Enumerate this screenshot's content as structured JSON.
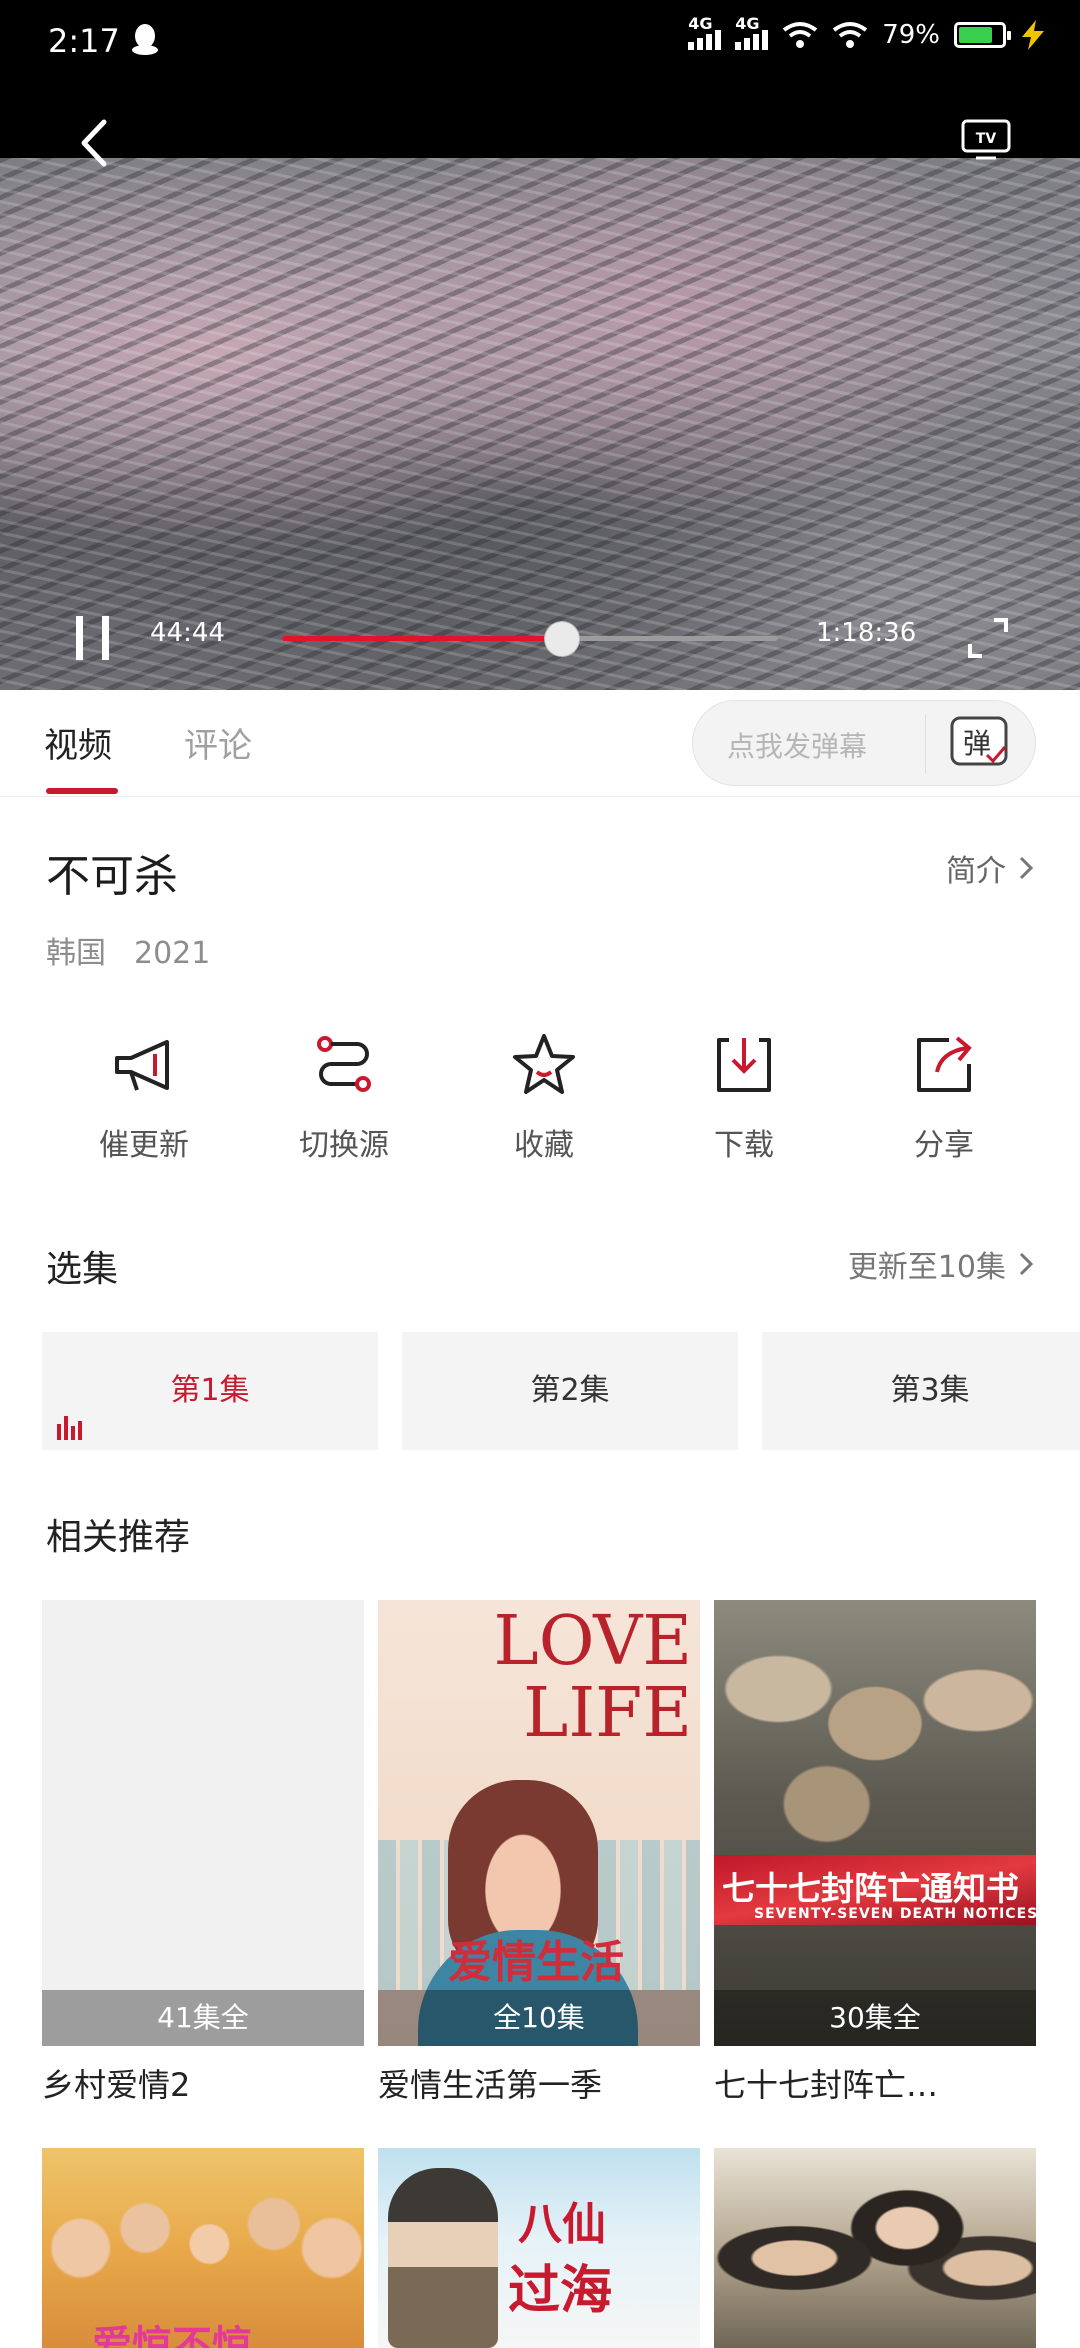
{
  "status_bar": {
    "time": "2:17",
    "net1": "4G",
    "net2": "4G",
    "battery_text": "79%",
    "battery_level": 0.79,
    "icons": [
      "qq-icon",
      "signal-icon",
      "wifi-icon",
      "battery-icon",
      "charging-icon"
    ]
  },
  "player": {
    "current_time": "44:44",
    "total_time": "1:18:36",
    "progress": 0.5654,
    "accent_color": "#e0142a"
  },
  "tabs": [
    {
      "label": "视频",
      "active": true
    },
    {
      "label": "评论",
      "active": false
    }
  ],
  "danmu": {
    "placeholder": "点我发弹幕",
    "icon_label": "弹"
  },
  "show": {
    "title": "不可杀",
    "intro_label": "简介",
    "region": "韩国",
    "year": "2021"
  },
  "actions": [
    {
      "label": "催更新",
      "icon": "megaphone-icon"
    },
    {
      "label": "切换源",
      "icon": "switch-source-icon"
    },
    {
      "label": "收藏",
      "icon": "star-icon"
    },
    {
      "label": "下载",
      "icon": "download-icon"
    },
    {
      "label": "分享",
      "icon": "share-icon"
    }
  ],
  "episodes": {
    "title": "选集",
    "update_label": "更新至10集",
    "items": [
      {
        "label": "第1集",
        "active": true
      },
      {
        "label": "第2集",
        "active": false
      },
      {
        "label": "第3集",
        "active": false
      }
    ]
  },
  "recommend": {
    "title": "相关推荐",
    "items": [
      {
        "name": "乡村爱情2",
        "badge": "41集全"
      },
      {
        "name": "爱情生活第一季",
        "badge": "全10集",
        "poster_title": "LOVE LIFE",
        "poster_cn": "爱情生活"
      },
      {
        "name": "七十七封阵亡…",
        "badge": "30集全",
        "poster_cn": "七十七封阵亡通知书",
        "poster_en": "SEVENTY-SEVEN DEATH NOTICES"
      },
      {
        "name": "",
        "poster_cn": "爱惊不惊"
      },
      {
        "name": "",
        "poster_cn1": "八仙",
        "poster_cn2": "过海"
      },
      {
        "name": ""
      }
    ]
  },
  "colors": {
    "accent": "#c8192f",
    "player_bg": "#000000"
  }
}
